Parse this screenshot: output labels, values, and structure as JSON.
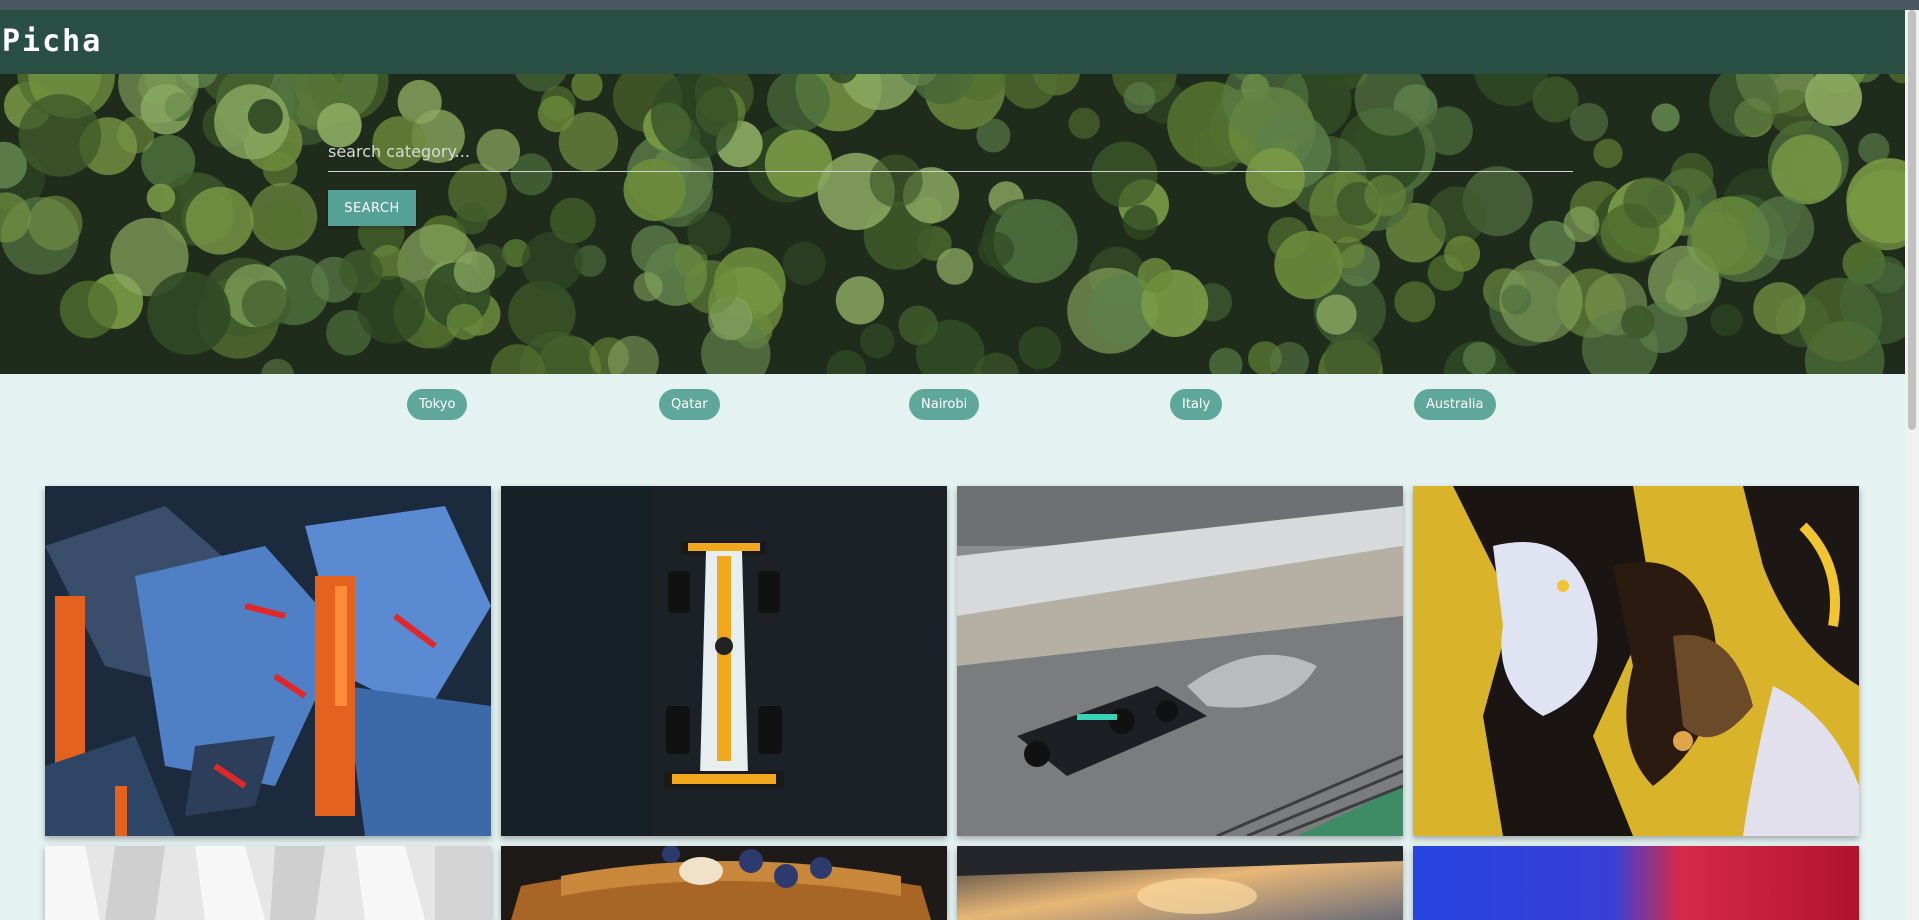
{
  "brand": {
    "name": "Picha"
  },
  "search": {
    "placeholder": "search category...",
    "value": "",
    "button_label": "SEARCH"
  },
  "categories": [
    {
      "label": "Tokyo"
    },
    {
      "label": "Qatar"
    },
    {
      "label": "Nairobi"
    },
    {
      "label": "Italy"
    },
    {
      "label": "Australia"
    }
  ],
  "gallery": [
    {
      "subject": "abstract-blue-orange-painting"
    },
    {
      "subject": "orange-f1-car-overhead"
    },
    {
      "subject": "f1-car-wet-track"
    },
    {
      "subject": "abstract-fluid-art"
    },
    {
      "subject": "white-architecture"
    },
    {
      "subject": "pancakes-blueberries"
    },
    {
      "subject": "sunset-sky"
    },
    {
      "subject": "blue-red-gradient"
    }
  ],
  "colors": {
    "navbar": "#294f44",
    "accent": "#5ea79a",
    "page_background": "#e4f2f2"
  }
}
